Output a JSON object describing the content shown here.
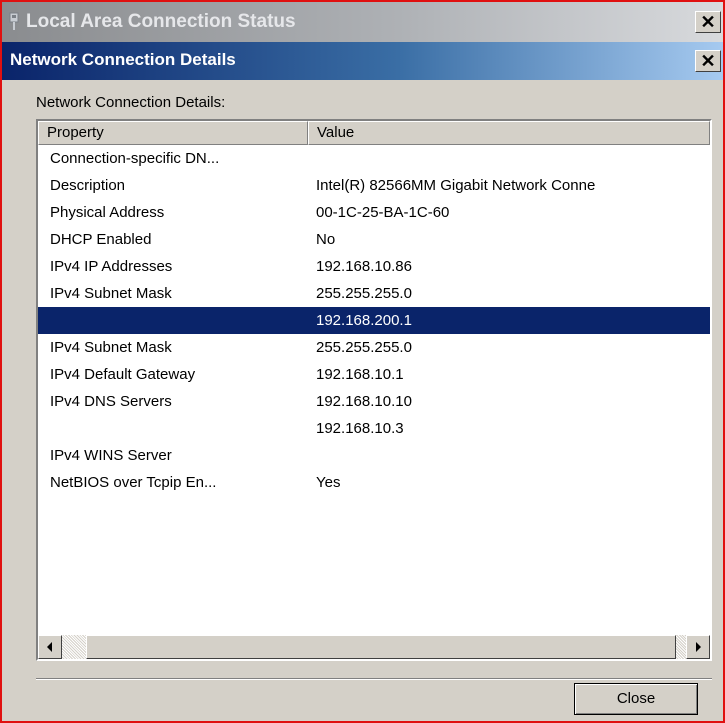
{
  "back_window": {
    "title": "Local Area Connection Status",
    "close_glyph": "✕"
  },
  "dialog": {
    "title": "Network Connection Details",
    "close_glyph": "✕",
    "group_label": "Network Connection Details:",
    "columns": [
      "Property",
      "Value"
    ],
    "rows": [
      {
        "property": "Connection-specific DN...",
        "value": ""
      },
      {
        "property": "Description",
        "value": "Intel(R) 82566MM Gigabit Network Conne"
      },
      {
        "property": "Physical Address",
        "value": "00-1C-25-BA-1C-60"
      },
      {
        "property": "DHCP Enabled",
        "value": "No"
      },
      {
        "property": "IPv4 IP Addresses",
        "value": "192.168.10.86"
      },
      {
        "property": "IPv4 Subnet Mask",
        "value": "255.255.255.0"
      },
      {
        "property": "",
        "value": "192.168.200.1",
        "selected": true
      },
      {
        "property": "IPv4 Subnet Mask",
        "value": "255.255.255.0"
      },
      {
        "property": "IPv4 Default Gateway",
        "value": "192.168.10.1"
      },
      {
        "property": "IPv4 DNS Servers",
        "value": "192.168.10.10"
      },
      {
        "property": "",
        "value": "192.168.10.3"
      },
      {
        "property": "IPv4 WINS Server",
        "value": ""
      },
      {
        "property": "NetBIOS over Tcpip En...",
        "value": "Yes"
      }
    ],
    "close_button_label": "Close"
  },
  "icons": {
    "back_window_icon": "network-connection-icon",
    "scroll_left": "arrow-left-icon",
    "scroll_right": "arrow-right-icon"
  },
  "colors": {
    "selection_bg": "#0a246a",
    "active_title": "#0a246a",
    "inactive_title": "#8a8c8f",
    "dialog_face": "#d4d0c8",
    "highlight_frame": "#e01010"
  }
}
